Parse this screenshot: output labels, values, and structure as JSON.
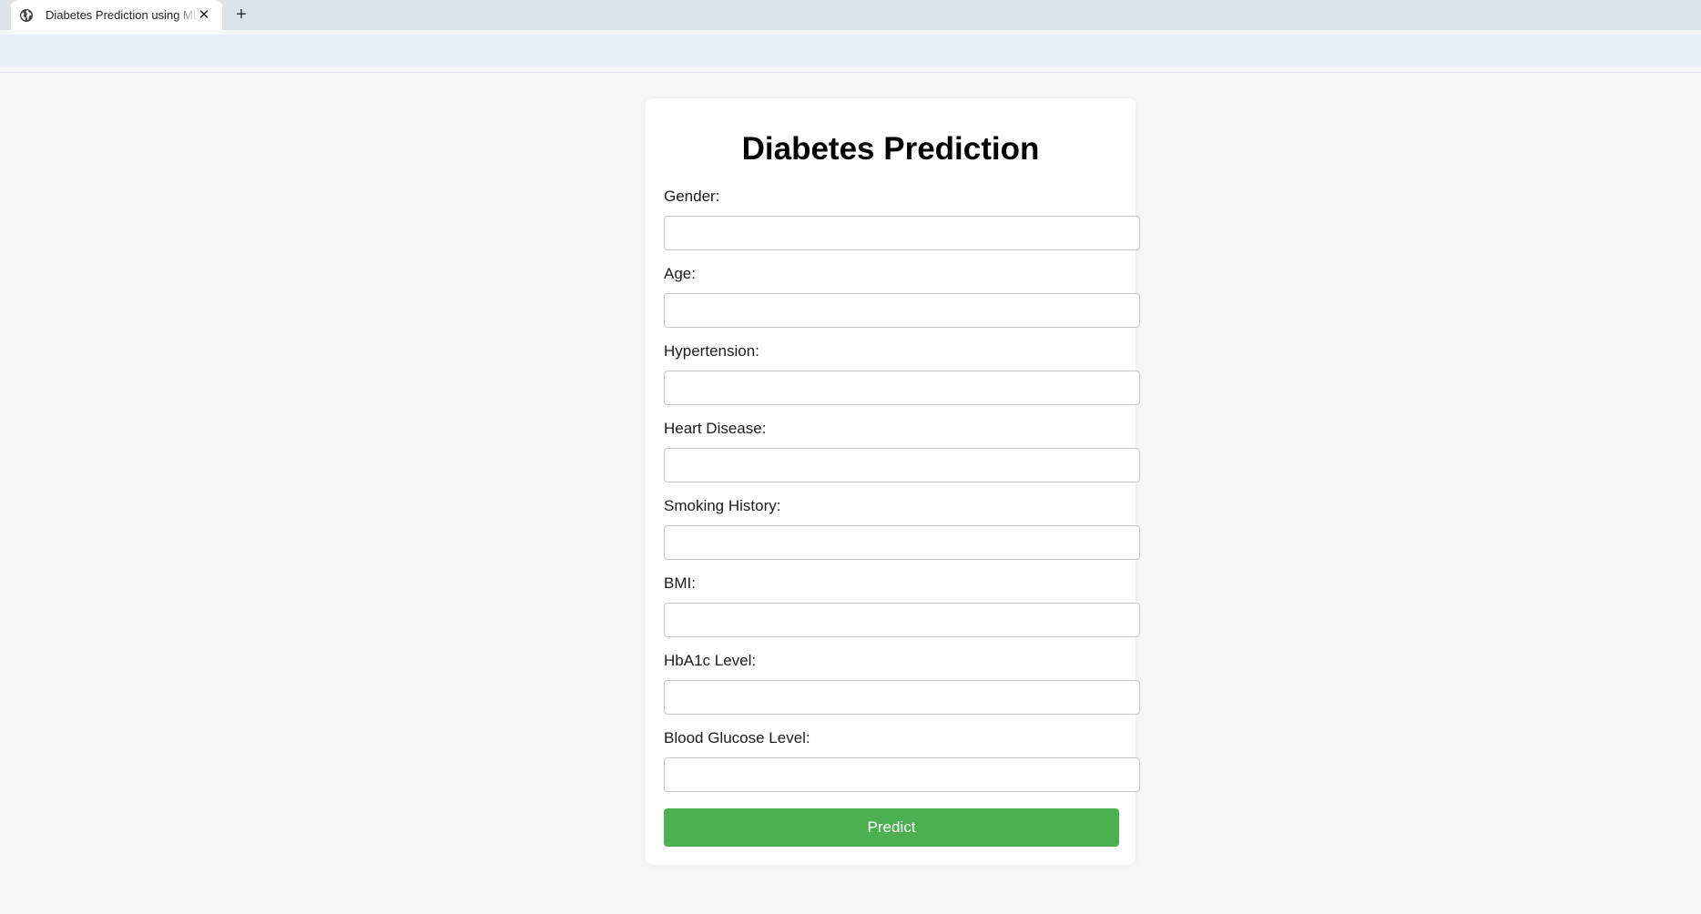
{
  "browser": {
    "tab_title": "Diabetes Prediction using ML Model",
    "tab_favicon": "globe-icon",
    "close_icon": "close-icon",
    "new_tab_icon": "plus-icon"
  },
  "form": {
    "title": "Diabetes Prediction",
    "fields": [
      {
        "label": "Gender:",
        "value": "",
        "placeholder": ""
      },
      {
        "label": "Age:",
        "value": "",
        "placeholder": ""
      },
      {
        "label": "Hypertension:",
        "value": "",
        "placeholder": ""
      },
      {
        "label": "Heart Disease:",
        "value": "",
        "placeholder": ""
      },
      {
        "label": "Smoking History:",
        "value": "",
        "placeholder": ""
      },
      {
        "label": "BMI:",
        "value": "",
        "placeholder": ""
      },
      {
        "label": "HbA1c Level:",
        "value": "",
        "placeholder": ""
      },
      {
        "label": "Blood Glucose Level:",
        "value": "",
        "placeholder": ""
      }
    ],
    "submit_label": "Predict"
  },
  "colors": {
    "accent": "#4caf50",
    "page_background": "#f6f6f6",
    "tabstrip": "#dee3ea",
    "toolbar": "#eaeef7"
  }
}
